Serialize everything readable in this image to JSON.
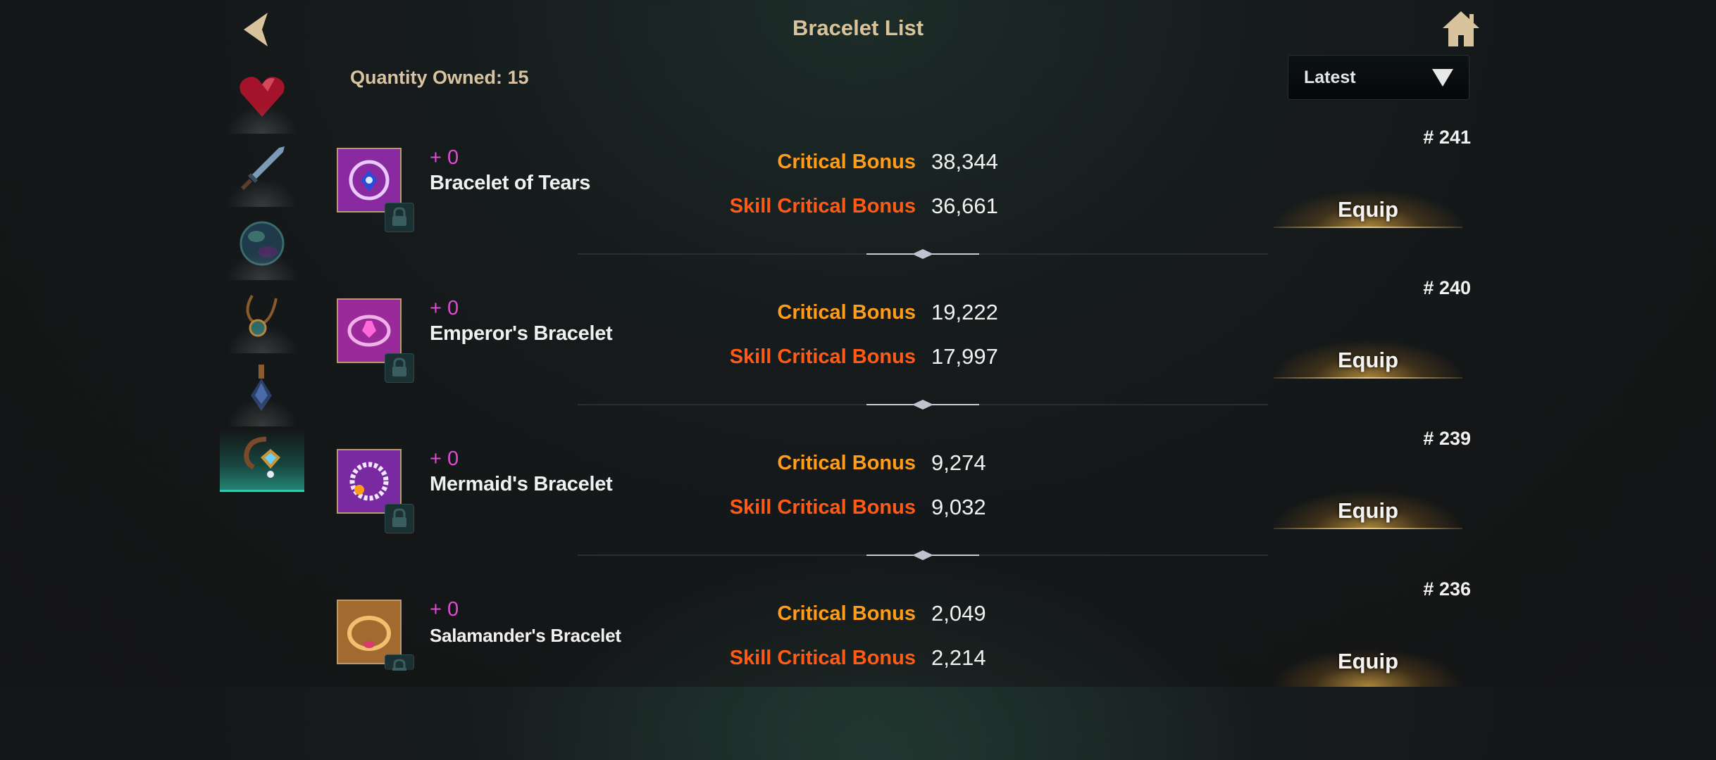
{
  "header": {
    "title": "Bracelet List"
  },
  "quantity_text": "Quantity Owned: 15",
  "sort": {
    "selected": "Latest"
  },
  "sidebar": {
    "items": [
      {
        "icon": "heart-gem-icon"
      },
      {
        "icon": "sword-icon"
      },
      {
        "icon": "orb-icon"
      },
      {
        "icon": "necklace-icon"
      },
      {
        "icon": "earring-icon"
      },
      {
        "icon": "bracelet-icon",
        "active": true
      }
    ]
  },
  "bracelets": [
    {
      "id": "# 241",
      "enhance": "+ 0",
      "name": "Bracelet of Tears",
      "stat1_label": "Critical Bonus",
      "stat1_value": "38,344",
      "stat2_label": "Skill Critical Bonus",
      "stat2_value": "36,661",
      "equip": "Equip",
      "color": "#8a2aa0"
    },
    {
      "id": "# 240",
      "enhance": "+ 0",
      "name": "Emperor's Bracelet",
      "stat1_label": "Critical Bonus",
      "stat1_value": "19,222",
      "stat2_label": "Skill Critical Bonus",
      "stat2_value": "17,997",
      "equip": "Equip",
      "color": "#9a2a9a"
    },
    {
      "id": "# 239",
      "enhance": "+ 0",
      "name": "Mermaid's Bracelet",
      "stat1_label": "Critical Bonus",
      "stat1_value": "9,274",
      "stat2_label": "Skill Critical Bonus",
      "stat2_value": "9,032",
      "equip": "Equip",
      "color": "#7a2aa0"
    },
    {
      "id": "# 236",
      "enhance": "+ 0",
      "name": "Salamander's Bracelet",
      "stat1_label": "Critical Bonus",
      "stat1_value": "2,049",
      "stat2_label": "Skill Critical Bonus",
      "stat2_value": "2,214",
      "equip": "Equip",
      "color": "#a36a30"
    }
  ],
  "colors": {
    "gold": "#d9c39a",
    "critical": "#ff9c1a",
    "skill_critical": "#ff5a16",
    "enhance": "#e24ad6"
  }
}
